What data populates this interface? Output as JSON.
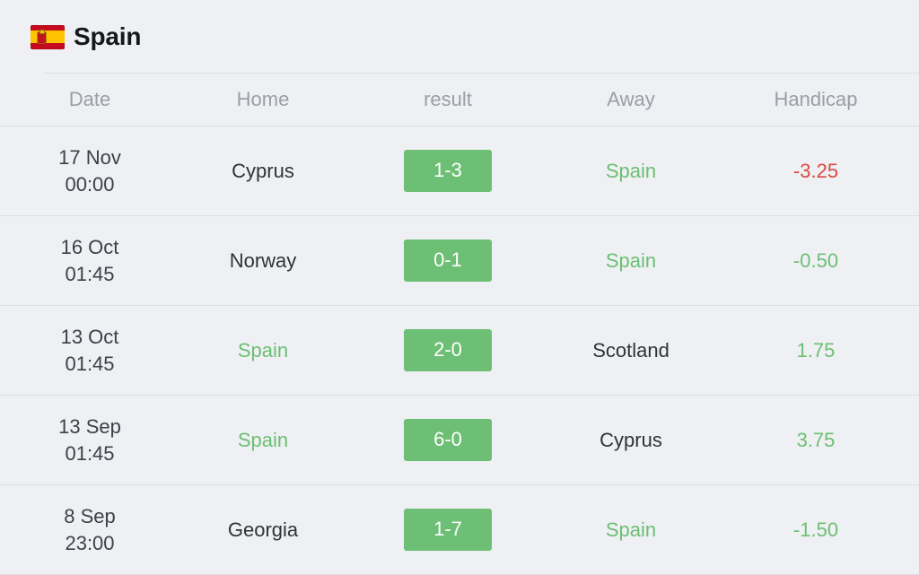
{
  "header": {
    "flag_icon": "spain-flag-icon",
    "title": "Spain"
  },
  "table": {
    "columns": [
      {
        "key": "date",
        "label": "Date"
      },
      {
        "key": "home",
        "label": "Home"
      },
      {
        "key": "result",
        "label": "result"
      },
      {
        "key": "away",
        "label": "Away"
      },
      {
        "key": "handicap",
        "label": "Handicap"
      }
    ],
    "rows": [
      {
        "date_day": "17 Nov",
        "date_time": "00:00",
        "home": "Cyprus",
        "home_highlight": false,
        "result": "1-3",
        "away": "Spain",
        "away_highlight": true,
        "handicap": "-3.25",
        "handicap_sign": "neg"
      },
      {
        "date_day": "16 Oct",
        "date_time": "01:45",
        "home": "Norway",
        "home_highlight": false,
        "result": "0-1",
        "away": "Spain",
        "away_highlight": true,
        "handicap": "-0.50",
        "handicap_sign": "pos"
      },
      {
        "date_day": "13 Oct",
        "date_time": "01:45",
        "home": "Spain",
        "home_highlight": true,
        "result": "2-0",
        "away": "Scotland",
        "away_highlight": false,
        "handicap": "1.75",
        "handicap_sign": "pos"
      },
      {
        "date_day": "13 Sep",
        "date_time": "01:45",
        "home": "Spain",
        "home_highlight": true,
        "result": "6-0",
        "away": "Cyprus",
        "away_highlight": false,
        "handicap": "3.75",
        "handicap_sign": "pos"
      },
      {
        "date_day": "8 Sep",
        "date_time": "23:00",
        "home": "Georgia",
        "home_highlight": false,
        "result": "1-7",
        "away": "Spain",
        "away_highlight": true,
        "handicap": "-1.50",
        "handicap_sign": "pos"
      }
    ]
  },
  "colors": {
    "background": "#eff0f3",
    "badge_green": "#6cbf74",
    "text_green": "#6cbf74",
    "text_red": "#d94a42",
    "header_gray": "#9a9ea7",
    "text_dark": "#2f3338",
    "divider": "#dcdee3"
  }
}
